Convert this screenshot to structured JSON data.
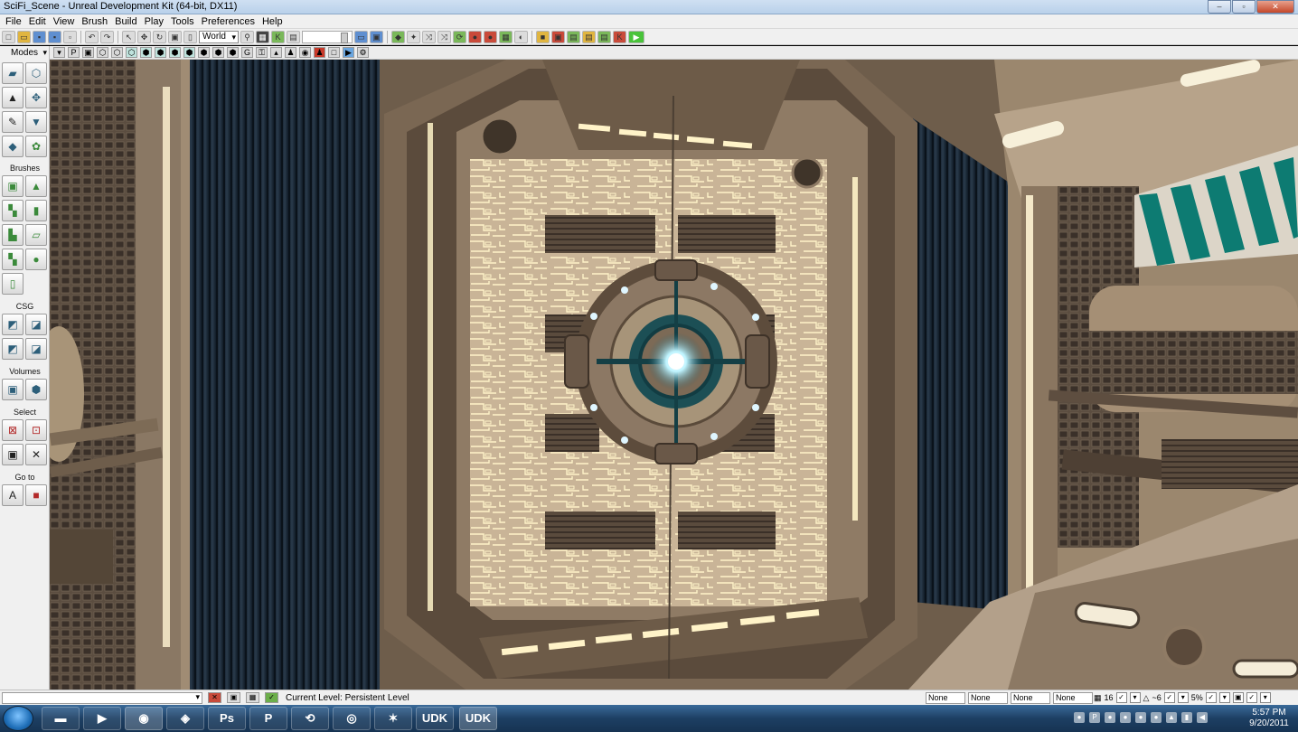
{
  "window": {
    "title": "SciFi_Scene - Unreal Development Kit (64-bit, DX11)",
    "controls": [
      "–",
      "▫",
      "✕"
    ]
  },
  "menu": [
    "File",
    "Edit",
    "View",
    "Brush",
    "Build",
    "Play",
    "Tools",
    "Preferences",
    "Help"
  ],
  "toolbar": {
    "coordinate_system": "World",
    "icons": [
      "new-icon",
      "open-icon",
      "save-icon",
      "save-all-icon",
      "undo-icon",
      "redo-icon",
      "select-icon",
      "translate-icon",
      "rotate-icon",
      "scale-icon",
      "search-icon",
      "content-browser-icon",
      "kismet-icon",
      "matinee-icon",
      "build-icon",
      "play-icon"
    ]
  },
  "mode_panel": {
    "header": "Modes",
    "sections": [
      "Brushes",
      "CSG",
      "Volumes",
      "Select",
      "Go to"
    ]
  },
  "viewport": {
    "name": "Perspective viewport",
    "colors": {
      "wall": "#6a5a48",
      "panel_light": "#b9a690",
      "panel_dark": "#4e4236",
      "glow": "#f5e6b8",
      "blue_column": "#1e2e3d",
      "teal_stripe": "#0d7b72",
      "core_light": "#bff4ff"
    }
  },
  "status": {
    "current_level": "Current Level:  Persistent Level",
    "fields": [
      "None",
      "None",
      "None",
      "None"
    ],
    "grid": "16",
    "rotation_snap": "~6",
    "scale_snap": "5%"
  },
  "taskbar": {
    "apps": [
      "explorer",
      "media",
      "firefox",
      "unity",
      "Ps",
      "P",
      "steam",
      "maya",
      "zbrush",
      "UDK",
      "UDK"
    ],
    "clock_time": "5:57 PM",
    "clock_date": "9/20/2011"
  }
}
